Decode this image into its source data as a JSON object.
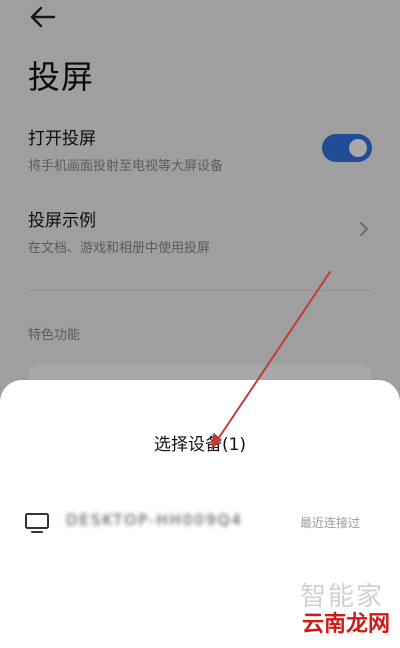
{
  "page": {
    "title": "投屏",
    "cast_toggle": {
      "title": "打开投屏",
      "subtitle": "将手机画面投射至电视等大屏设备",
      "enabled": true
    },
    "cast_demo": {
      "title": "投屏示例",
      "subtitle": "在文档、游戏和相册中使用投屏"
    },
    "section_label": "特色功能"
  },
  "sheet": {
    "title": "选择设备(1)",
    "devices": [
      {
        "name": "DESKTOP-HH009Q4",
        "status": "最近连接过",
        "icon": "monitor-icon"
      }
    ]
  },
  "watermark": {
    "top": "智能家",
    "bottom": "云南龙网"
  },
  "colors": {
    "accent": "#2f72e6",
    "annotation": "#c23a3a",
    "watermark_red": "#d11a14"
  }
}
